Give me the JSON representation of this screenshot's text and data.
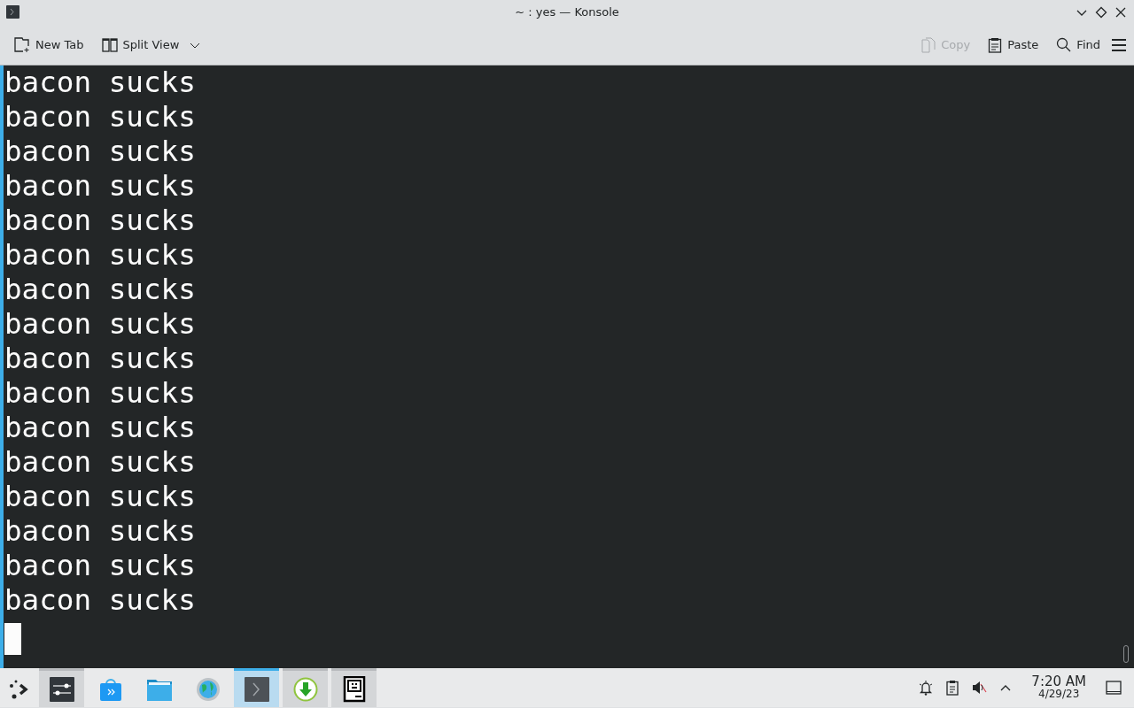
{
  "window": {
    "title": "~ : yes — Konsole"
  },
  "toolbar": {
    "left": [
      {
        "kind": "newtab",
        "label": "New Tab",
        "disabled": false
      },
      {
        "kind": "split",
        "label": "Split View",
        "disabled": false
      }
    ],
    "right": [
      {
        "kind": "copy",
        "label": "Copy",
        "disabled": true
      },
      {
        "kind": "paste",
        "label": "Paste",
        "disabled": false
      },
      {
        "kind": "find",
        "label": "Find",
        "disabled": false
      }
    ]
  },
  "terminal": {
    "lines": [
      "bacon sucks",
      "bacon sucks",
      "bacon sucks",
      "bacon sucks",
      "bacon sucks",
      "bacon sucks",
      "bacon sucks",
      "bacon sucks",
      "bacon sucks",
      "bacon sucks",
      "bacon sucks",
      "bacon sucks",
      "bacon sucks",
      "bacon sucks",
      "bacon sucks",
      "bacon sucks"
    ]
  },
  "taskbar": {
    "apps": [
      {
        "running": true,
        "active": false
      },
      {
        "running": false,
        "active": false
      },
      {
        "running": false,
        "active": false
      },
      {
        "running": false,
        "active": false
      },
      {
        "running": true,
        "active": true
      },
      {
        "running": true,
        "active": false
      },
      {
        "running": true,
        "active": false
      }
    ],
    "clock": {
      "time": "7:20 AM",
      "date": "4/29/23"
    }
  }
}
